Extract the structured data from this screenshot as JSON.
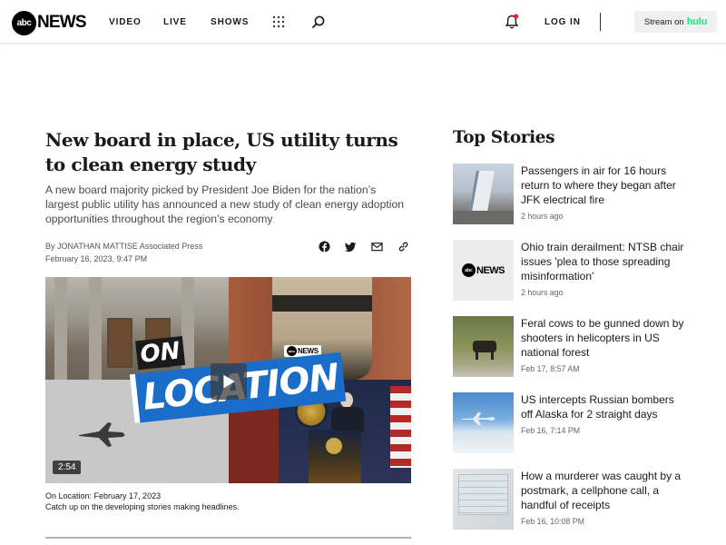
{
  "header": {
    "logo_circle": "abc",
    "logo_word": "NEWS",
    "nav": [
      {
        "label": "VIDEO"
      },
      {
        "label": "LIVE"
      },
      {
        "label": "SHOWS"
      }
    ],
    "login_label": "LOG IN",
    "stream_label": "Stream on",
    "stream_brand": "hulu",
    "icons": {
      "grid": "grid-icon",
      "search": "search-icon",
      "notifications": "bell-icon"
    },
    "accent_color": "#1ce783",
    "notification_dot_color": "#e0282e"
  },
  "article": {
    "headline": "New board in place, US utility turns to clean energy study",
    "dek": "A new board majority picked by President Joe Biden for the nation’s largest public utility has announced a new study of clean energy adoption opportunities throughout the region’s economy",
    "byline_prefix": "By",
    "author": "JONATHAN MATTISE",
    "source": "Associated Press",
    "date": "February 16, 2023, 9:47 PM",
    "share_icons": [
      "facebook-icon",
      "twitter-icon",
      "email-icon",
      "link-icon"
    ],
    "video": {
      "title_line1": "ON",
      "title_line2": "LOCATION",
      "badge_circle": "abc",
      "badge_word": "NEWS",
      "duration": "2:54",
      "caption_title": "On Location: February 17, 2023",
      "caption_text": "Catch up on the developing stories making headlines."
    }
  },
  "top_stories": {
    "title": "Top Stories",
    "items": [
      {
        "headline": "Passengers in air for 16 hours return to where they began after JFK electrical fire",
        "time": "2 hours ago"
      },
      {
        "headline": "Ohio train derailment: NTSB chair issues 'plea to those spreading misinformation'",
        "time": "2 hours ago",
        "thumb_circle": "abc",
        "thumb_word": "NEWS"
      },
      {
        "headline": "Feral cows to be gunned down by shooters in helicopters in US national forest",
        "time": "Feb 17, 8:57 AM"
      },
      {
        "headline": "US intercepts Russian bombers off Alaska for 2 straight days",
        "time": "Feb 16, 7:14 PM"
      },
      {
        "headline": "How a murderer was caught by a postmark, a cellphone call, a handful of receipts",
        "time": "Feb 16, 10:08 PM"
      }
    ]
  }
}
